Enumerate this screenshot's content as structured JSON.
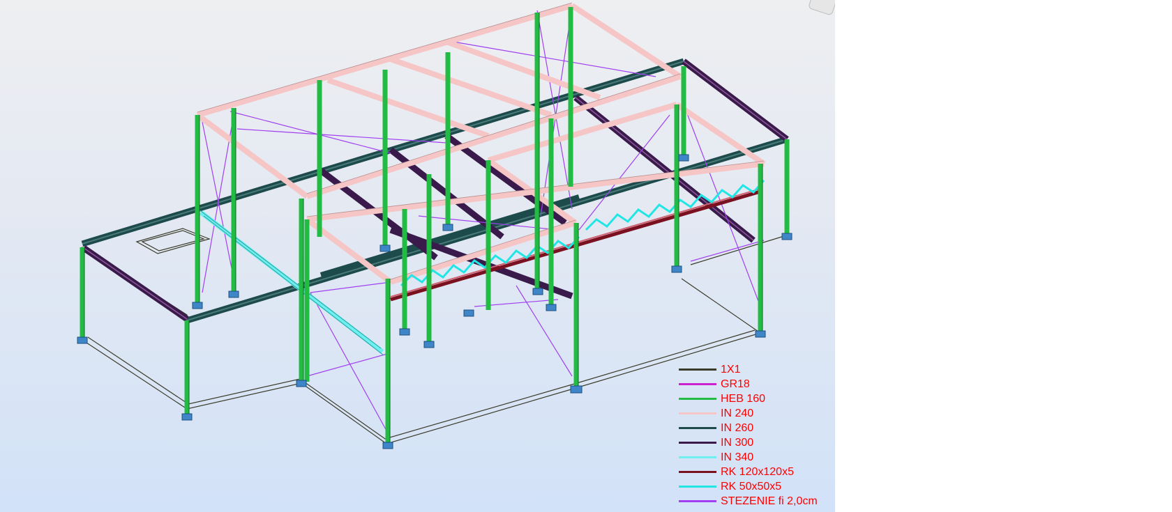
{
  "viewport": {
    "background_top": "#eeeff1",
    "background_bottom": "#d2e2f8"
  },
  "legend": {
    "items": [
      {
        "label": "1X1",
        "color": "#3b3b2a"
      },
      {
        "label": "GR18",
        "color": "#cc22cc"
      },
      {
        "label": "HEB 160",
        "color": "#22bb44"
      },
      {
        "label": "IN 240",
        "color": "#f6c6c6"
      },
      {
        "label": "IN 260",
        "color": "#1d4a4a"
      },
      {
        "label": "IN 300",
        "color": "#3a1a4a"
      },
      {
        "label": "IN 340",
        "color": "#6ff0f0"
      },
      {
        "label": "RK 120x120x5",
        "color": "#7a1020"
      },
      {
        "label": "RK 50x50x5",
        "color": "#22e6e6"
      },
      {
        "label": "STEZENIE fi 2,0cm",
        "color": "#a040f0"
      }
    ]
  },
  "icons": {
    "view_cube": "view-cube-icon",
    "support": "support-icon"
  }
}
